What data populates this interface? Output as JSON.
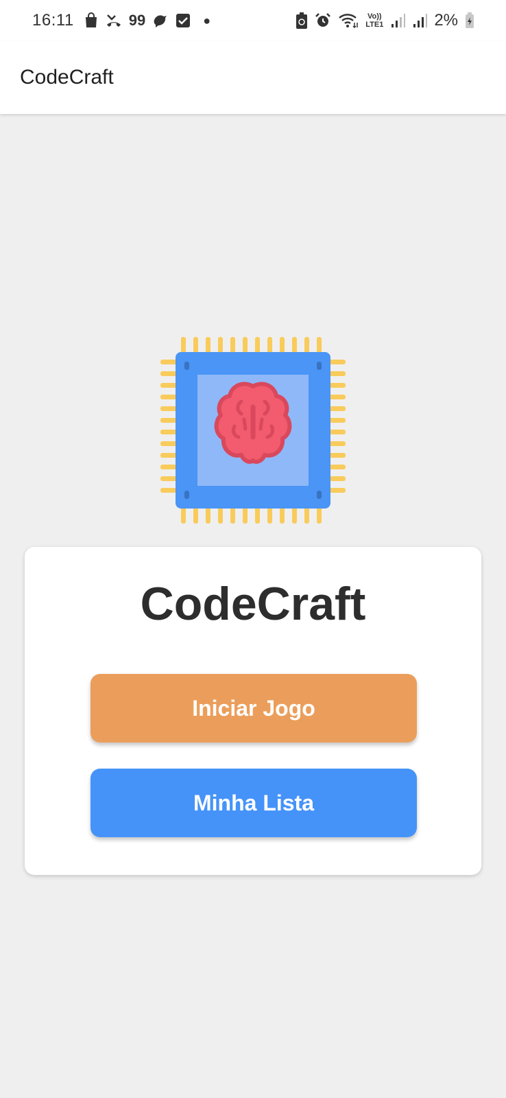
{
  "status_bar": {
    "time": "16:11",
    "badge_text": "99",
    "network_label_top": "Vo))",
    "network_label_bottom": "LTE1",
    "battery_percent": "2%",
    "icons": [
      "shopping-bag-icon",
      "missed-call-icon",
      "bird-icon",
      "checkbox-icon",
      "dot-icon",
      "battery-saver-icon",
      "alarm-icon",
      "wifi-icon",
      "volte-icon",
      "signal-icon",
      "signal-icon",
      "battery-charging-icon"
    ]
  },
  "app_bar": {
    "title": "CodeCraft"
  },
  "logo": {
    "icon": "chip-brain-icon",
    "colors": {
      "chip_body": "#4a95f5",
      "chip_inner": "#8fb8f8",
      "pins": "#f9cb5a",
      "brain": "#f25c6e",
      "brain_outline": "#d9485c"
    }
  },
  "card": {
    "title": "CodeCraft",
    "start_button_label": "Iniciar Jogo",
    "list_button_label": "Minha Lista"
  },
  "colors": {
    "background": "#efefef",
    "start_button": "#eb9e5b",
    "list_button": "#4593f8"
  }
}
